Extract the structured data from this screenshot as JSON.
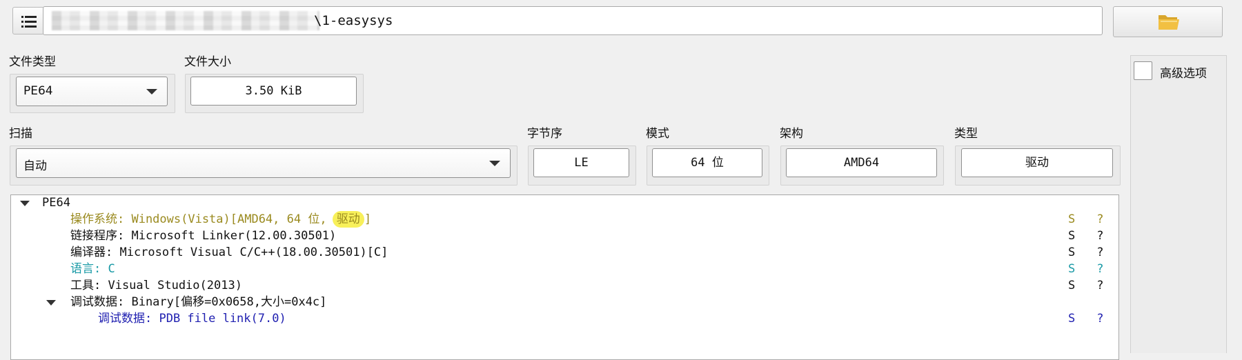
{
  "toolbar": {
    "menu_icon": "menu-list-icon",
    "path_value": "\\1-easysys",
    "folder_icon": "folder-open-icon",
    "folder_color": "#f2c042"
  },
  "file_type": {
    "label": "文件类型",
    "value": "PE64"
  },
  "file_size": {
    "label": "文件大小",
    "value": "3.50 KiB"
  },
  "scan": {
    "label": "扫描",
    "value": "自动"
  },
  "endianness": {
    "label": "字节序",
    "value": "LE"
  },
  "mode": {
    "label": "模式",
    "value": "64 位"
  },
  "arch": {
    "label": "架构",
    "value": "AMD64"
  },
  "type": {
    "label": "类型",
    "value": "驱动"
  },
  "advanced": {
    "label": "高级选项",
    "checked": false
  },
  "tree": {
    "root": "PE64",
    "items": [
      {
        "text": "操作系统: Windows(Vista)[AMD64, 64 位, ",
        "highlight": "驱动",
        "tail": "]",
        "color": "#9a8a1f",
        "s": "S",
        "q": "?"
      },
      {
        "text": "链接程序: Microsoft Linker(12.00.30501)",
        "color": "#111111",
        "s": "S",
        "q": "?"
      },
      {
        "text": "编译器: Microsoft Visual C/C++(18.00.30501)[C]",
        "color": "#111111",
        "s": "S",
        "q": "?"
      },
      {
        "text": "语言: C",
        "color": "#1a9aa6",
        "s": "S",
        "q": "?"
      },
      {
        "text": "工具: Visual Studio(2013)",
        "color": "#111111",
        "s": "S",
        "q": "?"
      },
      {
        "text": "调试数据: Binary[偏移=0x0658,大小=0x4c]",
        "color": "#111111"
      },
      {
        "text": "调试数据: PDB file link(7.0)",
        "color": "#1f1fb0",
        "s": "S",
        "q": "?"
      }
    ]
  }
}
